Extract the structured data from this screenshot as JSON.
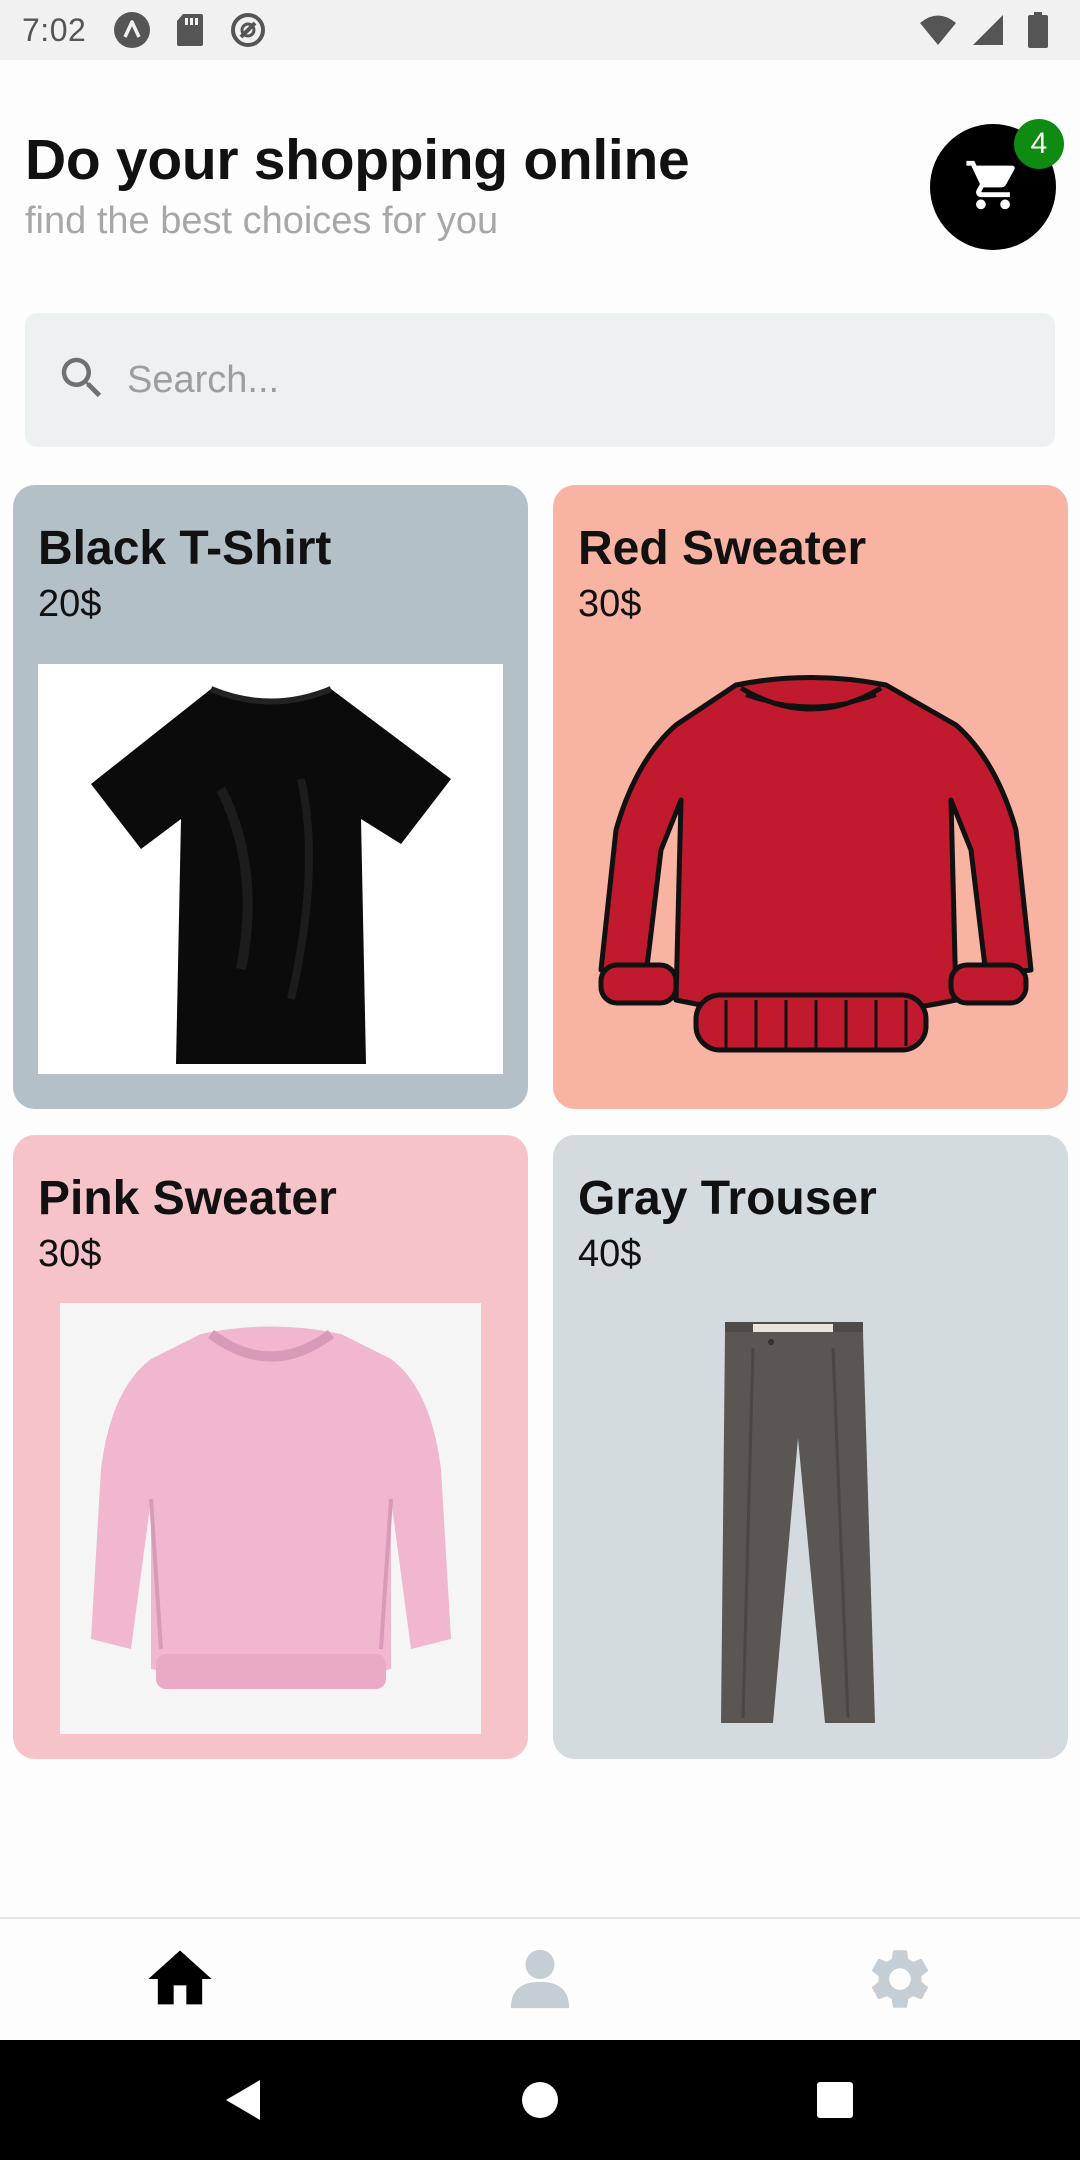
{
  "status_bar": {
    "time": "7:02",
    "left_icons": [
      "app-a-icon",
      "sd-card-icon",
      "sync-icon"
    ],
    "right_icons": [
      "wifi-icon",
      "signal-icon",
      "battery-icon"
    ]
  },
  "header": {
    "title": "Do your shopping online",
    "subtitle": "find the best choices for you"
  },
  "cart": {
    "icon": "cart-icon",
    "badge_count": "4"
  },
  "search": {
    "icon": "search-icon",
    "placeholder": "Search..."
  },
  "products": [
    {
      "name": "Black T-Shirt",
      "price": "20$",
      "card_color": "#b4c0c7",
      "image": "black-tshirt-image"
    },
    {
      "name": "Red Sweater",
      "price": "30$",
      "card_color": "#f9b3a2",
      "image": "red-sweater-image"
    },
    {
      "name": "Pink Sweater",
      "price": "30$",
      "card_color": "#f6c4c8",
      "image": "pink-sweater-image"
    },
    {
      "name": "Gray Trouser",
      "price": "40$",
      "card_color": "#d3dbdf",
      "image": "gray-trouser-image"
    }
  ],
  "bottom_nav": {
    "items": [
      {
        "icon": "home-icon",
        "active": true
      },
      {
        "icon": "user-icon",
        "active": false
      },
      {
        "icon": "settings-icon",
        "active": false
      }
    ]
  },
  "colors": {
    "active_nav": "#000000",
    "inactive_nav": "#c5ced4",
    "badge": "#0f8a12"
  }
}
